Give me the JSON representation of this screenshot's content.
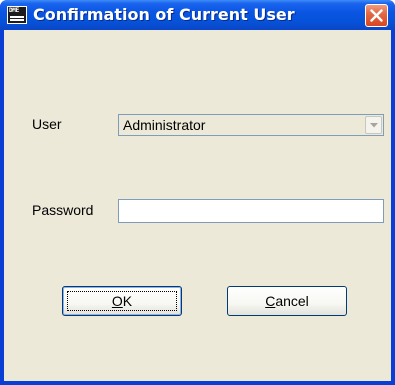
{
  "window": {
    "title": "Confirmation of Current User",
    "icon": "dme-app-icon",
    "icon_text": "DME"
  },
  "form": {
    "user_label": "User",
    "user_value": "Administrator",
    "password_label": "Password",
    "password_value": ""
  },
  "buttons": {
    "ok_mnemonic": "O",
    "ok_rest": "K",
    "cancel_mnemonic": "C",
    "cancel_rest": "ancel"
  },
  "colors": {
    "titlebar": "#0a55e3",
    "dialog_bg": "#ece9d8",
    "close_button": "#e26a45"
  }
}
